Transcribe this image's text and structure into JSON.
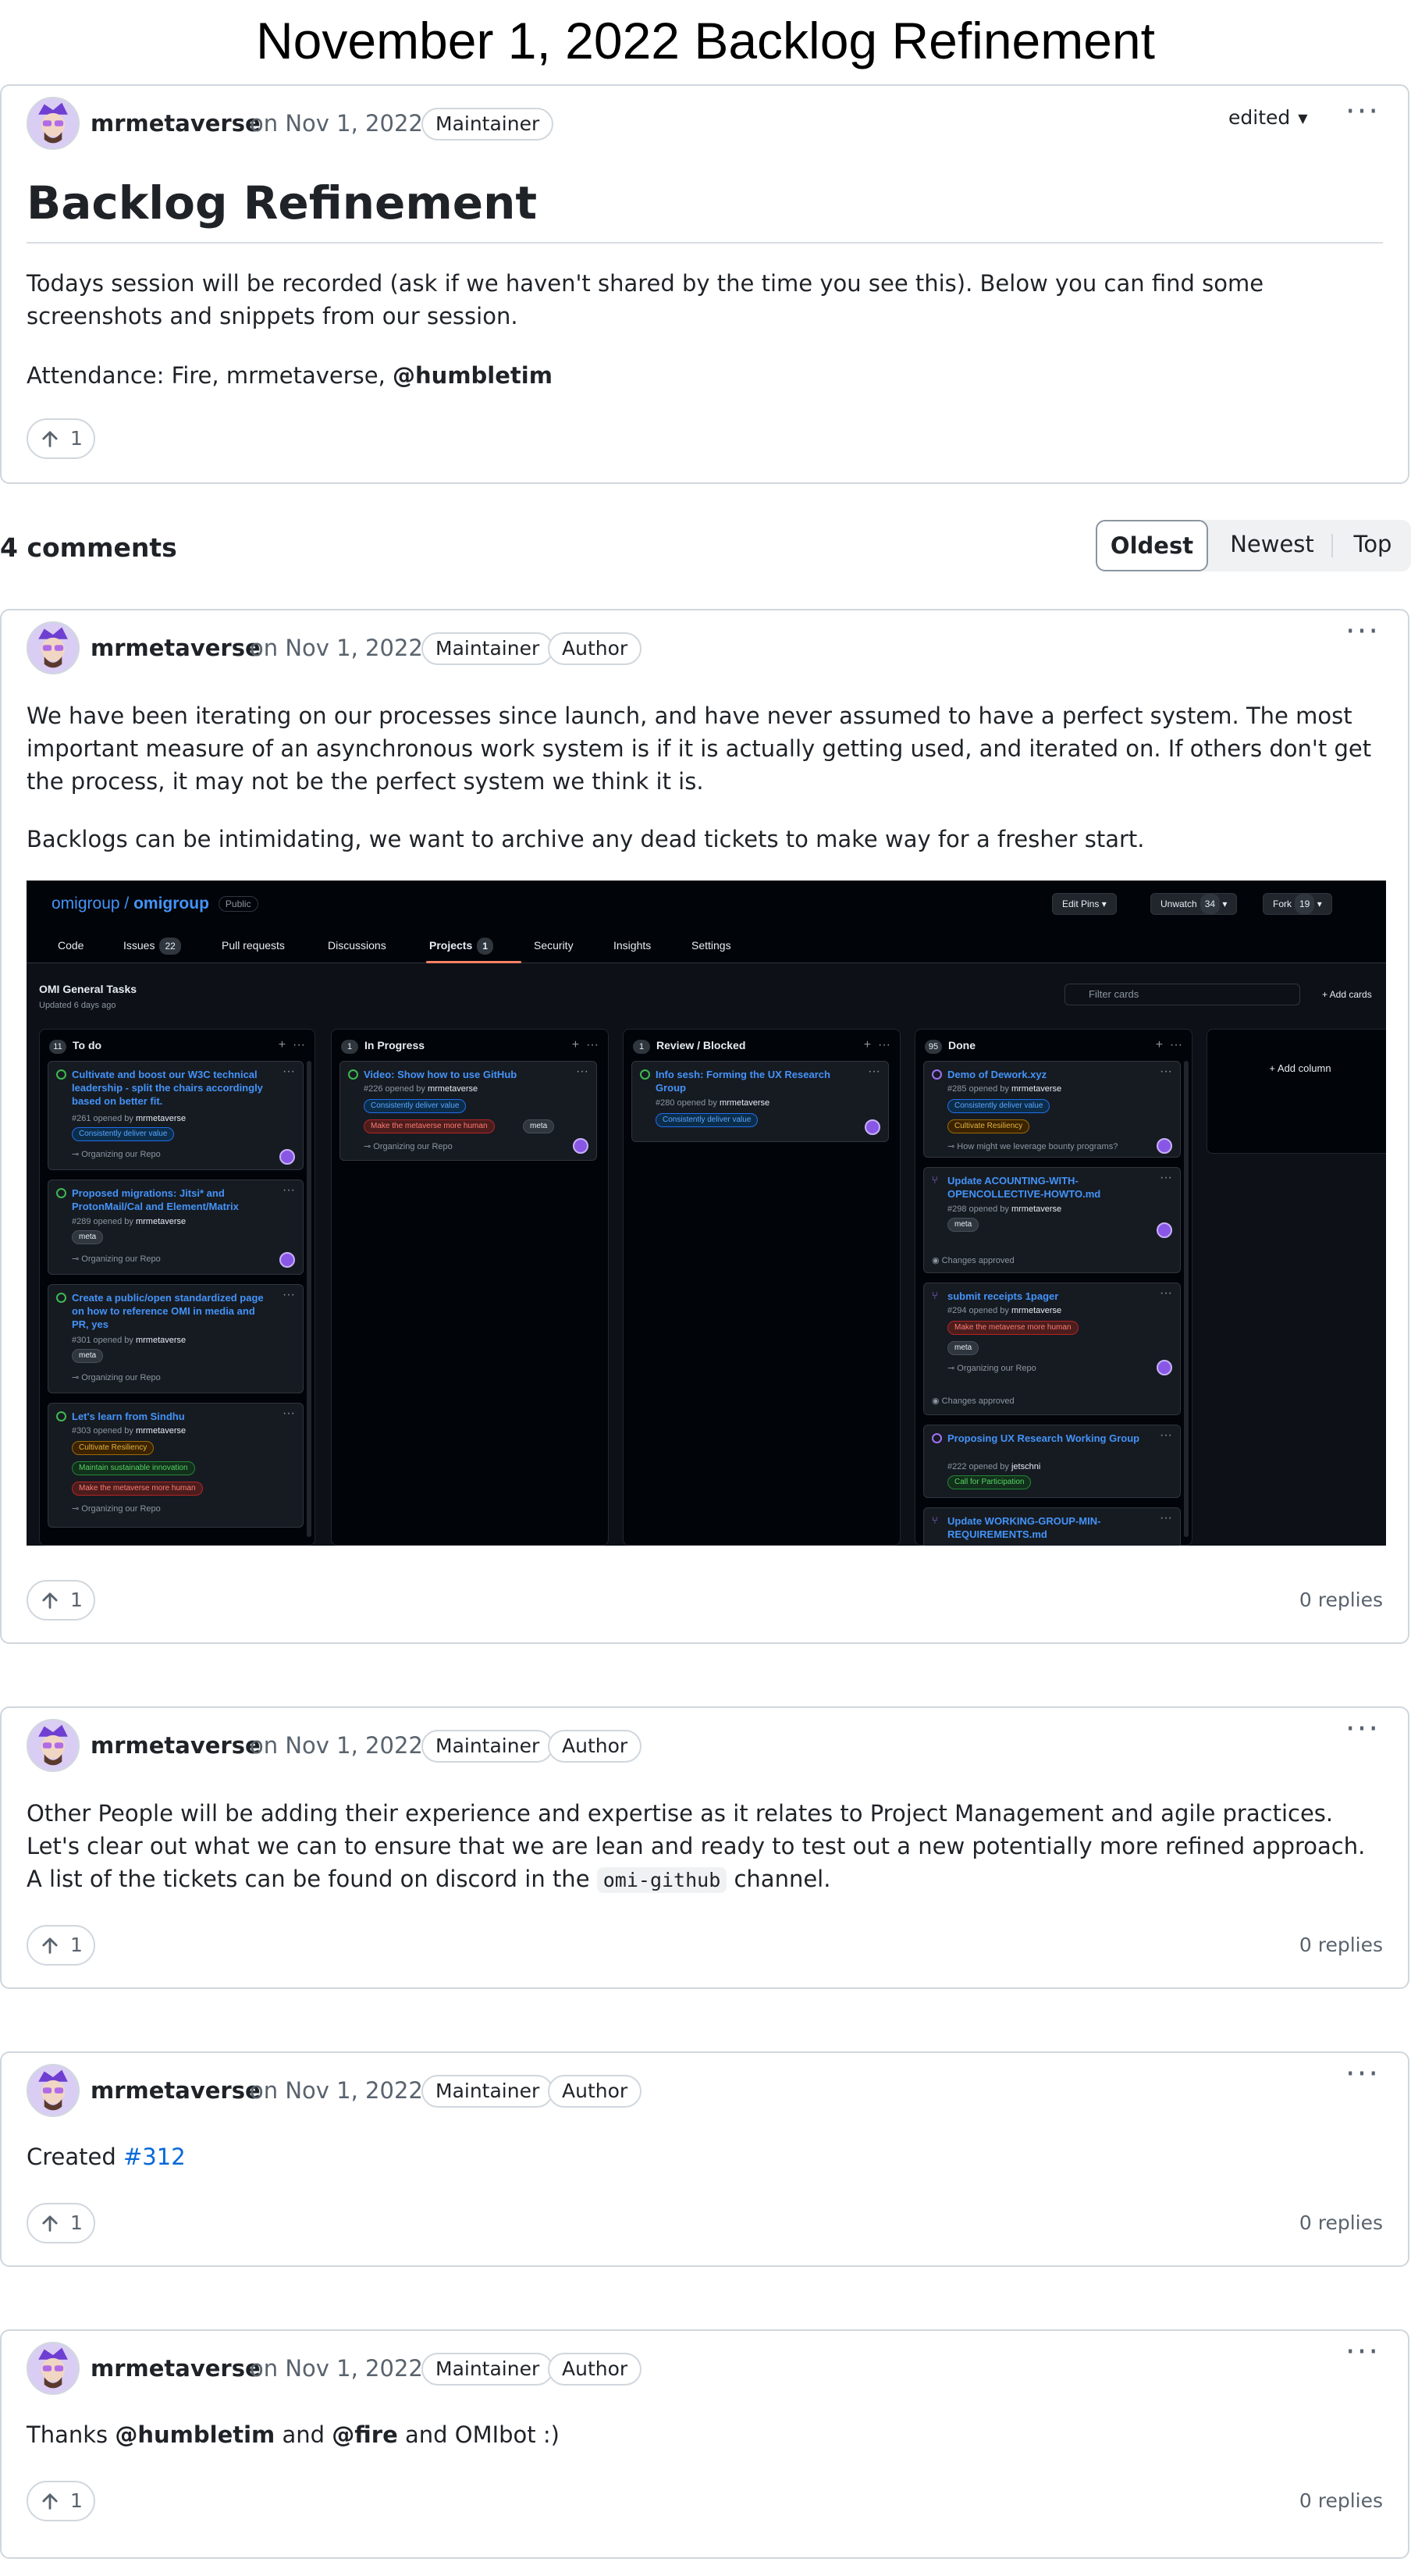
{
  "page": {
    "title": "November 1, 2022 Backlog Refinement"
  },
  "post": {
    "author": "mrmetaverse",
    "date": "on Nov 1, 2022",
    "role": "Maintainer",
    "edited_label": "edited",
    "heading": "Backlog Refinement",
    "para1": "Todays session will be recorded (ask if we haven't shared by the time you see this). Below you can find some screenshots and snippets from our session.",
    "attendance_prefix": "Attendance: Fire, mrmetaverse, ",
    "attendance_mention": "@humbletim",
    "upvotes": "1"
  },
  "comments_header": {
    "count_label": "4 comments",
    "sort_options": [
      "Oldest",
      "Newest",
      "Top"
    ],
    "active_sort": "Oldest"
  },
  "comments": [
    {
      "author": "mrmetaverse",
      "date": "on Nov 1, 2022",
      "roles": [
        "Maintainer",
        "Author"
      ],
      "para1": "We have been iterating on our processes since launch, and have never assumed to have a perfect system. The most important measure of an asynchronous work system is if it is actually getting used, and iterated on. If others don't get the process, it may not be the perfect system we think it is.",
      "para2": "Backlogs can be intimidating, we want to archive any dead tickets to make way for a fresher start.",
      "upvotes": "1",
      "replies": "0 replies"
    },
    {
      "author": "mrmetaverse",
      "date": "on Nov 1, 2022",
      "roles": [
        "Maintainer",
        "Author"
      ],
      "para1_before": "Other People will be adding their experience and expertise as it relates to Project Management and agile practices. Let's clear out what we can to ensure that we are lean and ready to test out a new potentially more refined approach. A list of the tickets can be found on discord in the ",
      "code": "omi-github",
      "para1_after": " channel.",
      "upvotes": "1",
      "replies": "0 replies"
    },
    {
      "author": "mrmetaverse",
      "date": "on Nov 1, 2022",
      "roles": [
        "Maintainer",
        "Author"
      ],
      "prefix": "Created ",
      "link": "#312",
      "upvotes": "1",
      "replies": "0 replies"
    },
    {
      "author": "mrmetaverse",
      "date": "on Nov 1, 2022",
      "roles": [
        "Maintainer",
        "Author"
      ],
      "t1": "Thanks ",
      "m1": "@humbletim",
      "t2": " and ",
      "m2": "@fire",
      "t3": " and OMIbot :)",
      "upvotes": "1",
      "replies": "0 replies"
    }
  ],
  "board": {
    "org": "omigroup",
    "repo": "omigroup",
    "visibility": "Public",
    "edit_pins": "Edit Pins",
    "unwatch": "Unwatch",
    "unwatch_count": "34",
    "fork": "Fork",
    "fork_count": "19",
    "tabs": [
      {
        "label": "Code"
      },
      {
        "label": "Issues",
        "count": "22"
      },
      {
        "label": "Pull requests"
      },
      {
        "label": "Discussions"
      },
      {
        "label": "Projects",
        "count": "1"
      },
      {
        "label": "Security"
      },
      {
        "label": "Insights"
      },
      {
        "label": "Settings"
      }
    ],
    "project_title": "OMI General Tasks",
    "project_updated": "Updated 6 days ago",
    "filter_placeholder": "Filter cards",
    "add_cards": "+ Add cards",
    "add_column": "+ Add column",
    "columns": [
      {
        "name": "To do",
        "count": "11",
        "cards": [
          {
            "title": "Cultivate and boost our W3C technical leadership - split the chairs accordingly based on better fit.",
            "meta": "#261 opened by",
            "user": "mrmetaverse",
            "labels": [
              "Consistently deliver value"
            ],
            "foot": "Organizing our Repo"
          },
          {
            "title": "Proposed migrations: Jitsi* and ProtonMail/Cal and Element/Matrix",
            "meta": "#289 opened by",
            "user": "mrmetaverse",
            "labels": [
              "meta"
            ],
            "foot": "Organizing our Repo"
          },
          {
            "title": "Create a public/open standardized page on how to reference OMI in media and PR, yes",
            "meta": "#301 opened by",
            "user": "mrmetaverse",
            "labels": [
              "meta"
            ],
            "foot": "Organizing our Repo"
          },
          {
            "title": "Let's learn from Sindhu",
            "meta": "#303 opened by",
            "user": "mrmetaverse",
            "labels": [
              "Cultivate Resiliency",
              "Maintain sustainable innovation",
              "Make the metaverse more human"
            ],
            "foot": "Organizing our Repo"
          }
        ]
      },
      {
        "name": "In Progress",
        "count": "1",
        "cards": [
          {
            "title": "Video: Show how to use GitHub",
            "meta": "#226 opened by",
            "user": "mrmetaverse",
            "labels": [
              "Consistently deliver value",
              "Make the metaverse more human",
              "meta"
            ],
            "foot": "Organizing our Repo"
          }
        ]
      },
      {
        "name": "Review / Blocked",
        "count": "1",
        "cards": [
          {
            "title": "Info sesh: Forming the UX Research Group",
            "meta": "#280 opened by",
            "user": "mrmetaverse",
            "labels": [
              "Consistently deliver value"
            ]
          }
        ]
      },
      {
        "name": "Done",
        "count": "95",
        "cards": [
          {
            "title": "Demo of Dework.xyz",
            "meta": "#285 opened by",
            "user": "mrmetaverse",
            "labels": [
              "Consistently deliver value",
              "Cultivate Resiliency"
            ],
            "foot": "How might we leverage bounty programs?"
          },
          {
            "title": "Update ACOUNTING-WITH-OPENCOLLECTIVE-HOWTO.md",
            "meta": "#298 opened by",
            "user": "mrmetaverse",
            "labels": [
              "meta"
            ],
            "foot": "Changes approved"
          },
          {
            "title": "submit receipts 1pager",
            "meta": "#294 opened by",
            "user": "mrmetaverse",
            "labels": [
              "Make the metaverse more human",
              "meta"
            ],
            "foot": "Organizing our Repo",
            "foot2": "Changes approved"
          },
          {
            "title": "Proposing UX Research Working Group",
            "meta": "#222 opened by",
            "user": "jetschni",
            "labels": [
              "Call for Participation"
            ]
          },
          {
            "title": "Update WORKING-GROUP-MIN-REQUIREMENTS.md"
          }
        ]
      }
    ]
  },
  "colors": {
    "border": "#d0d7de",
    "text": "#1f2328",
    "muted": "#59636e",
    "link": "#0969da",
    "board_bg": "#0d1117",
    "board_link": "#4493f8"
  },
  "icons": [
    "kebab-icon",
    "upvote-arrow-icon",
    "chevron-down-icon",
    "avatar-image"
  ]
}
